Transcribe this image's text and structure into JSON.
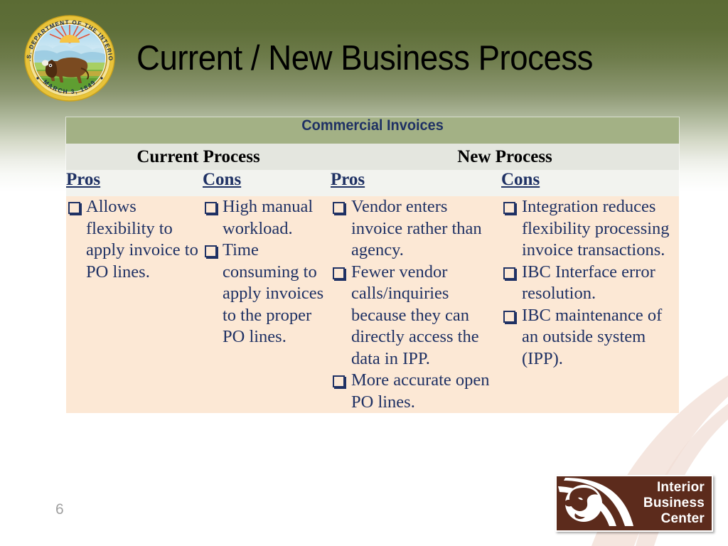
{
  "slide": {
    "title": "Current / New Business Process",
    "page_number": "6",
    "colors": {
      "background_top": "#5b6b34",
      "background_bottom": "#ffffff",
      "banner_bg": "#a3b185",
      "banner_text": "#1f3164",
      "group_header_bg": "#e4e6df",
      "sub_header_bg": "#f2f3ef",
      "body_bg": "#fce8d5",
      "body_text": "#1f3164",
      "logo_bg": "#5c2b1c",
      "page_number_color": "#a0a0a0"
    }
  },
  "seal": {
    "name": "us-department-of-the-interior-seal",
    "top_arc_text": "U.S. DEPARTMENT OF THE INTERIOR",
    "bottom_arc_text": "MARCH 3, 1849"
  },
  "table": {
    "banner": "Commercial Invoices",
    "groups": [
      {
        "label": "Current Process"
      },
      {
        "label": "New Process"
      }
    ],
    "columns": [
      {
        "sub_header": "Pros",
        "group": "Current Process",
        "items": [
          "Allows flexibility to apply invoice to PO lines."
        ]
      },
      {
        "sub_header": "Cons",
        "group": "Current Process",
        "items": [
          "High manual workload.",
          "Time consuming to apply invoices to the proper PO lines."
        ]
      },
      {
        "sub_header": "Pros",
        "group": "New Process",
        "items": [
          "Vendor enters invoice rather than agency.",
          "Fewer vendor calls/inquiries because they can directly access the data in IPP.",
          "More accurate open PO lines."
        ]
      },
      {
        "sub_header": "Cons",
        "group": "New Process",
        "items": [
          "Integration reduces flexibility processing invoice transactions.",
          "IBC Interface error resolution.",
          "IBC maintenance of an outside system (IPP)."
        ]
      }
    ]
  },
  "logo": {
    "name": "interior-business-center-logo",
    "line1": "Interior",
    "line2": "Business",
    "line3": "Center"
  }
}
